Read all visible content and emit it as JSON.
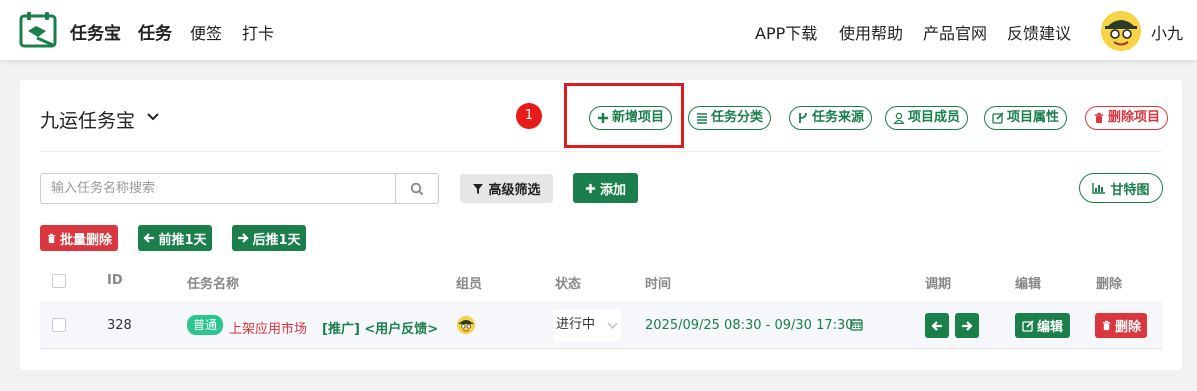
{
  "nav": {
    "brand": "任务宝",
    "tasks": "任务",
    "notes": "便签",
    "checkin": "打卡",
    "right_links": [
      "APP下载",
      "使用帮助",
      "产品官网",
      "反馈建议"
    ],
    "username": "小九"
  },
  "project": {
    "title": "九运任务宝",
    "annotation_badge": "1",
    "actions": {
      "new_project": "新增项目",
      "categories": "任务分类",
      "sources": "任务来源",
      "members": "项目成员",
      "properties": "项目属性",
      "delete_project": "删除项目"
    }
  },
  "toolbar": {
    "search_placeholder": "输入任务名称搜索",
    "advanced_filter": "高级筛选",
    "add": "添加",
    "gantt": "甘特图",
    "bulk_delete": "批量删除",
    "move_back": "前推1天",
    "move_forward": "后推1天"
  },
  "table": {
    "headers": {
      "id": "ID",
      "name": "任务名称",
      "member": "组员",
      "status": "状态",
      "time": "时间",
      "adjust": "调期",
      "edit": "编辑",
      "delete": "删除"
    },
    "rows": [
      {
        "id": "328",
        "priority": "普通",
        "name": "上架应用市场",
        "tags": "[推广] <用户反馈>",
        "status": "进行中",
        "time": "2025/09/25 08:30 - 09/30 17:30",
        "edit_label": "编辑",
        "delete_label": "删除"
      }
    ]
  },
  "colors": {
    "primary_green": "#1a7f4b",
    "danger_red": "#d9363e",
    "priority_teal": "#2cc48f",
    "highlight_red": "#e11b1b"
  }
}
